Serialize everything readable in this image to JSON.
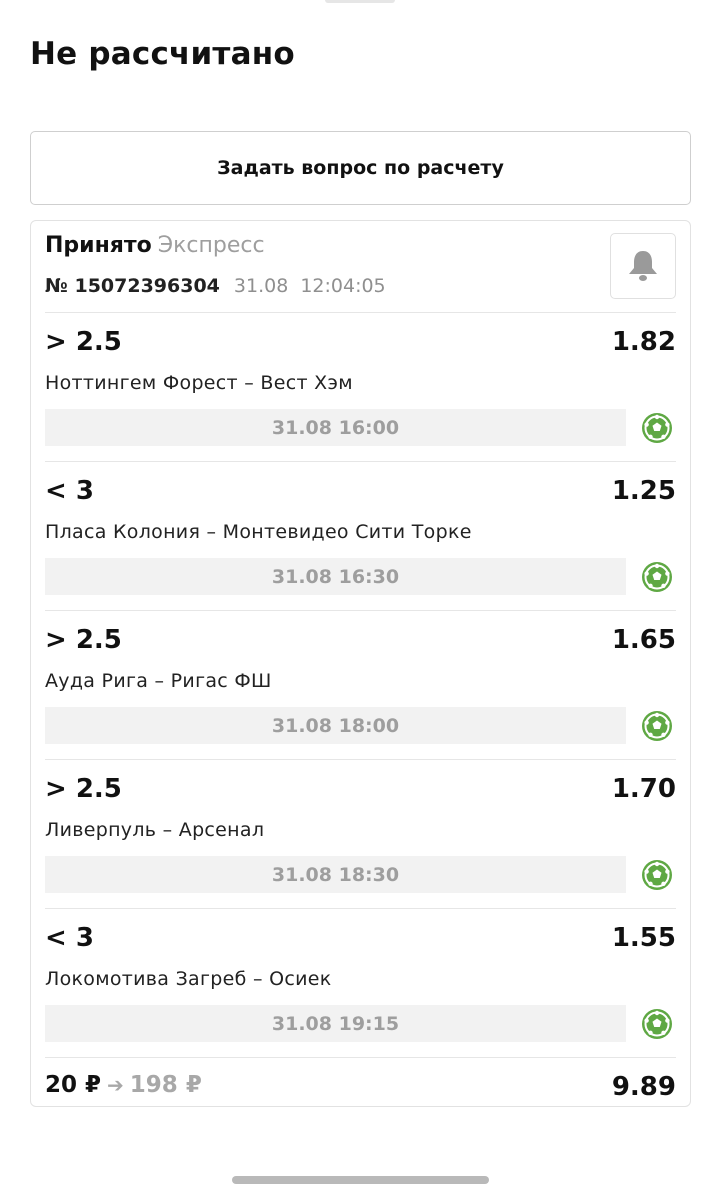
{
  "page": {
    "title": "Не рассчитано"
  },
  "ask_button": {
    "label": "Задать вопрос по расчету"
  },
  "bet": {
    "status": "Принято",
    "type": "Экспресс",
    "number": "№ 15072396304",
    "date": "31.08",
    "time": "12:04:05",
    "events": [
      {
        "outcome": "> 2.5",
        "odds": "1.82",
        "teams": "Ноттингем Форест – Вест Хэм",
        "start": "31.08 16:00",
        "sport_icon": "football-icon"
      },
      {
        "outcome": "< 3",
        "odds": "1.25",
        "teams": "Пласа Колония – Монтевидео Сити Торке",
        "start": "31.08 16:30",
        "sport_icon": "football-icon"
      },
      {
        "outcome": "> 2.5",
        "odds": "1.65",
        "teams": "Ауда Рига – Ригас ФШ",
        "start": "31.08 18:00",
        "sport_icon": "football-icon"
      },
      {
        "outcome": "> 2.5",
        "odds": "1.70",
        "teams": "Ливерпуль – Арсенал",
        "start": "31.08 18:30",
        "sport_icon": "football-icon"
      },
      {
        "outcome": "< 3",
        "odds": "1.55",
        "teams": "Локомотива Загреб – Осиек",
        "start": "31.08 19:15",
        "sport_icon": "football-icon"
      }
    ],
    "stake": "20 ₽",
    "potential_win": "198 ₽",
    "total_odds": "9.89"
  },
  "colors": {
    "accent_green": "#5fa844",
    "muted_text": "#9e9e9e",
    "divider": "#e6e6e6"
  }
}
